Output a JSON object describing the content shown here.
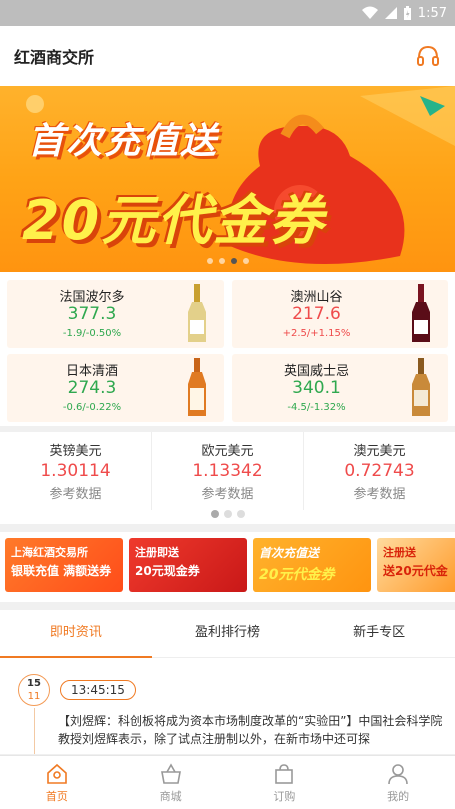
{
  "statusbar": {
    "time": "1:57"
  },
  "header": {
    "title": "红酒商交所"
  },
  "banner": {
    "line1": "首次充值送",
    "line2": "20元代金券"
  },
  "products": [
    {
      "name": "法国波尔多",
      "price": "377.3",
      "change": "-1.9/-0.50%",
      "trend": "down"
    },
    {
      "name": "澳洲山谷",
      "price": "217.6",
      "change": "+2.5/+1.15%",
      "trend": "up"
    },
    {
      "name": "日本清酒",
      "price": "274.3",
      "change": "-0.6/-0.22%",
      "trend": "down"
    },
    {
      "name": "英国威士忌",
      "price": "340.1",
      "change": "-4.5/-1.32%",
      "trend": "down"
    }
  ],
  "currencies": [
    {
      "name": "英镑美元",
      "value": "1.30114",
      "ref": "参考数据"
    },
    {
      "name": "欧元美元",
      "value": "1.13342",
      "ref": "参考数据"
    },
    {
      "name": "澳元美元",
      "value": "0.72743",
      "ref": "参考数据"
    }
  ],
  "promos": [
    {
      "a": "上海红酒交易所",
      "b": "银联充值 满额送券"
    },
    {
      "a": "注册即送",
      "b": "20元现金券"
    },
    {
      "a": "首次充值送",
      "b": "20元代金券"
    },
    {
      "a": "注册送",
      "b": "送20元代金"
    }
  ],
  "tabs": [
    "即时资讯",
    "盈利排行榜",
    "新手专区"
  ],
  "news": {
    "date_day": "15",
    "date_month": "11",
    "time": "13:45:15",
    "body": "【刘煜辉：科创板将成为资本市场制度改革的“实验田”】中国社会科学院教授刘煜辉表示，除了试点注册制以外，在新市场中还可探"
  },
  "nav": [
    "首页",
    "商城",
    "订购",
    "我的"
  ]
}
